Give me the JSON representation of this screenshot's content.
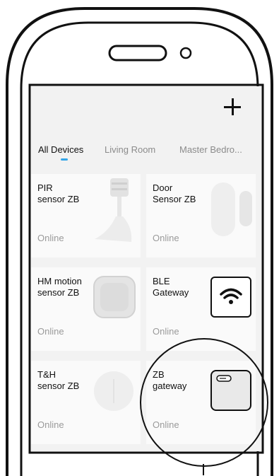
{
  "toolbar": {
    "add_icon": "plus-icon"
  },
  "tabs": [
    {
      "label": "All Devices",
      "active": true
    },
    {
      "label": "Living Room",
      "active": false
    },
    {
      "label": "Master Bedro...",
      "active": false
    }
  ],
  "devices": [
    {
      "name": "PIR\nsensor ZB",
      "status": "Online",
      "icon": "pir-sensor-image"
    },
    {
      "name": "Door\nSensor ZB",
      "status": "Online",
      "icon": "door-sensor-image"
    },
    {
      "name": "HM motion\nsensor ZB",
      "status": "Online",
      "icon": "motion-sensor-image"
    },
    {
      "name": "BLE\nGateway",
      "status": "Online",
      "icon": "wifi-icon"
    },
    {
      "name": "T&H\nsensor ZB",
      "status": "Online",
      "icon": "th-sensor-image"
    },
    {
      "name": "ZB\ngateway",
      "status": "Online",
      "icon": "zb-gateway-image"
    }
  ],
  "colors": {
    "tab_accent": "#35a6e8",
    "card_bg": "#fafafa",
    "screen_bg": "#f2f2f2"
  }
}
